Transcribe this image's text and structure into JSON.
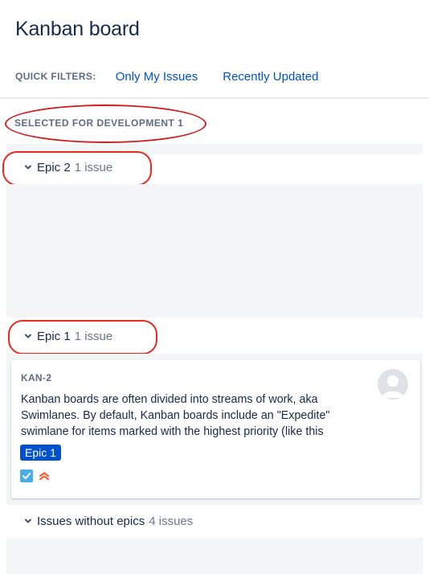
{
  "board": {
    "title": "Kanban board"
  },
  "quick_filters": {
    "label": "QUICK FILTERS:",
    "items": [
      "Only My Issues",
      "Recently Updated"
    ]
  },
  "column": {
    "name": "SELECTED FOR DEVELOPMENT",
    "count": "1"
  },
  "swimlanes": [
    {
      "name": "Epic 2",
      "count": "1 issue"
    },
    {
      "name": "Epic 1",
      "count": "1 issue"
    },
    {
      "name": "Issues without epics",
      "count": "4 issues"
    }
  ],
  "card": {
    "key": "KAN-2",
    "summary": "Kanban boards are often divided into streams of work, aka\nSwimlanes. By default, Kanban boards include an \"Expedite\"\nswimlane for items marked with the highest priority (like this",
    "epic": "Epic 1",
    "issue_type_icon": "task-checkbox-icon",
    "priority_icon": "highest-priority-icon"
  },
  "colors": {
    "link": "#0052cc",
    "annotation": "#e8291e",
    "epic_lozenge": "#0052cc",
    "priority": "#ff5630",
    "task": "#4bade8",
    "lane_background": "#f4f5f7"
  }
}
